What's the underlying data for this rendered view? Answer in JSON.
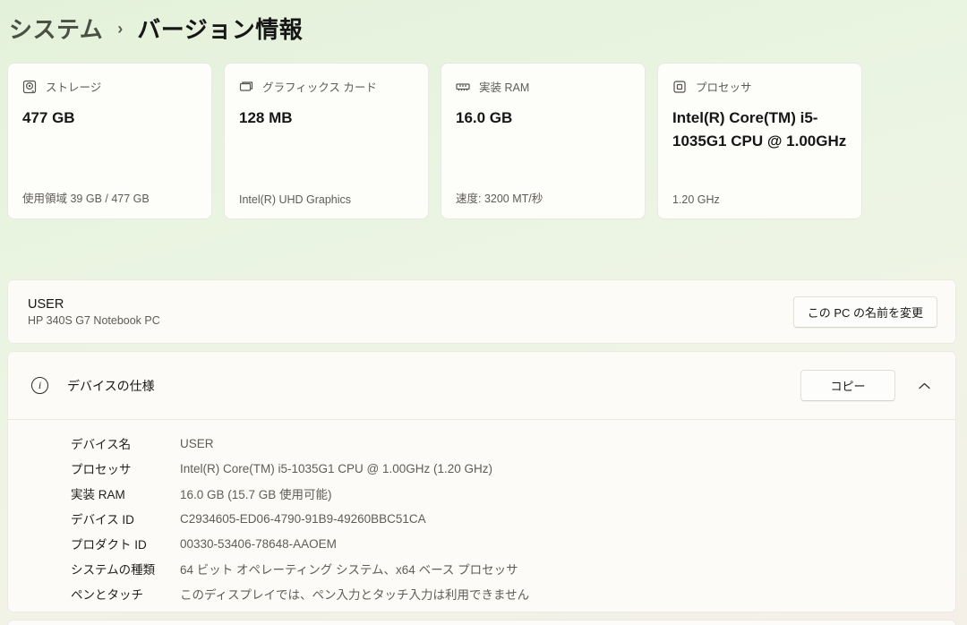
{
  "breadcrumb": {
    "parent": "システム",
    "separator": "›",
    "current": "バージョン情報"
  },
  "cards": [
    {
      "icon": "storage-icon",
      "label": "ストレージ",
      "value": "477 GB",
      "footer": "使用領域 39 GB / 477 GB"
    },
    {
      "icon": "gpu-icon",
      "label": "グラフィックス カード",
      "value": "128 MB",
      "footer": "Intel(R) UHD Graphics"
    },
    {
      "icon": "ram-icon",
      "label": "実装 RAM",
      "value": "16.0 GB",
      "footer": "速度: 3200 MT/秒"
    },
    {
      "icon": "cpu-icon",
      "label": "プロセッサ",
      "value": "Intel(R) Core(TM) i5-1035G1 CPU @ 1.00GHz",
      "footer": "1.20 GHz"
    }
  ],
  "device_banner": {
    "name": "USER",
    "model": "HP 340S G7 Notebook PC",
    "rename_button": "この PC の名前を変更"
  },
  "device_specs": {
    "title": "デバイスの仕様",
    "copy_button": "コピー",
    "rows": [
      {
        "label": "デバイス名",
        "value": "USER"
      },
      {
        "label": "プロセッサ",
        "value": "Intel(R) Core(TM) i5-1035G1 CPU @ 1.00GHz (1.20 GHz)"
      },
      {
        "label": "実装 RAM",
        "value": "16.0 GB (15.7 GB 使用可能)"
      },
      {
        "label": "デバイス ID",
        "value": "C2934605-ED06-4790-91B9-49260BBC51CA"
      },
      {
        "label": "プロダクト ID",
        "value": "00330-53406-78648-AAOEM"
      },
      {
        "label": "システムの種類",
        "value": "64 ビット オペレーティング システム、x64 ベース プロセッサ"
      },
      {
        "label": "ペンとタッチ",
        "value": "このディスプレイでは、ペン入力とタッチ入力は利用できません"
      }
    ]
  },
  "colors": {
    "background_top": "#e4f1da",
    "background_bottom": "#f4f0e8",
    "panel": "#fcfbf7",
    "text_primary": "#161616",
    "text_secondary": "#5d5b56"
  }
}
